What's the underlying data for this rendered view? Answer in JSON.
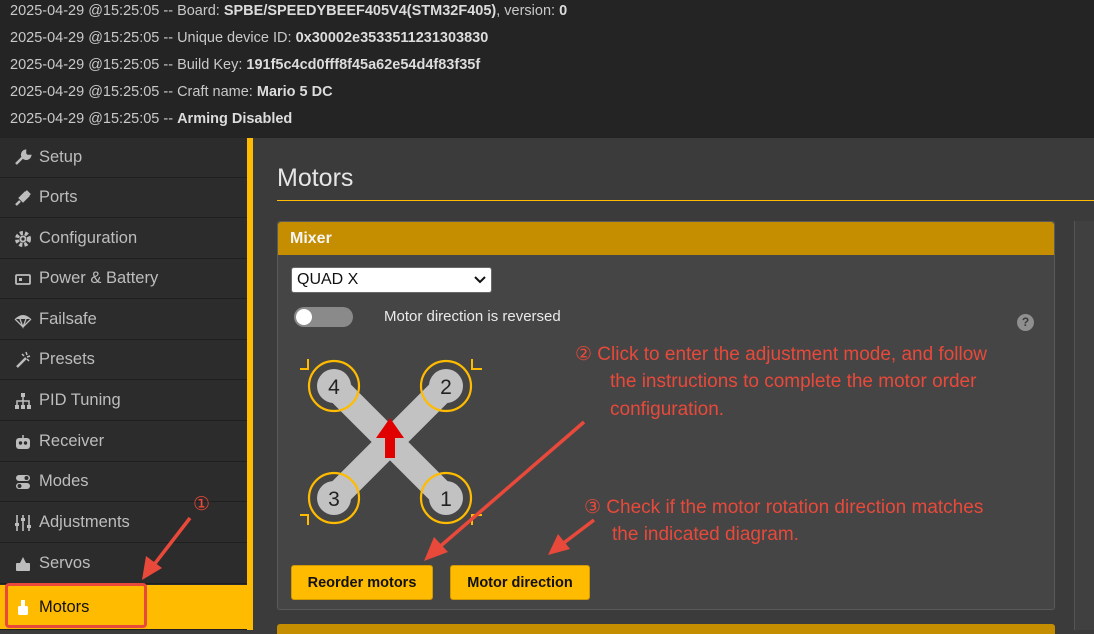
{
  "log": [
    {
      "prefix": "2025-04-29 @15:25:05 -- Board: ",
      "bold": "SPBE/SPEEDYBEEF405V4(STM32F405)",
      "suffix": ", version: ",
      "bold2": "0"
    },
    {
      "prefix": "2025-04-29 @15:25:05 -- Unique device ID: ",
      "bold": "0x30002e3533511231303830",
      "suffix": "",
      "bold2": ""
    },
    {
      "prefix": "2025-04-29 @15:25:05 -- Build Key: ",
      "bold": "191f5c4cd0fff8f45a62e54d4f83f35f",
      "suffix": "",
      "bold2": ""
    },
    {
      "prefix": "2025-04-29 @15:25:05 -- Craft name: ",
      "bold": "Mario 5 DC",
      "suffix": "",
      "bold2": ""
    },
    {
      "prefix": "2025-04-29 @15:25:05 -- ",
      "bold": "Arming Disabled",
      "suffix": "",
      "bold2": ""
    }
  ],
  "sidebar": {
    "items": [
      {
        "label": "Setup",
        "icon": "wrench-icon"
      },
      {
        "label": "Ports",
        "icon": "plug-icon"
      },
      {
        "label": "Configuration",
        "icon": "gear-icon"
      },
      {
        "label": "Power & Battery",
        "icon": "battery-icon"
      },
      {
        "label": "Failsafe",
        "icon": "parachute-icon"
      },
      {
        "label": "Presets",
        "icon": "magic-wand-icon"
      },
      {
        "label": "PID Tuning",
        "icon": "sitemap-icon"
      },
      {
        "label": "Receiver",
        "icon": "robot-icon"
      },
      {
        "label": "Modes",
        "icon": "toggle-icon"
      },
      {
        "label": "Adjustments",
        "icon": "sliders-icon"
      },
      {
        "label": "Servos",
        "icon": "servo-icon"
      },
      {
        "label": "Motors",
        "icon": "motor-icon"
      }
    ],
    "active": "Motors",
    "accent": "#ffbb00"
  },
  "main": {
    "title": "Motors",
    "mixer": {
      "header": "Mixer",
      "selected": "QUAD X",
      "toggle_label": "Motor direction is reversed",
      "toggle_on": false,
      "help": "?",
      "motors": [
        "4",
        "2",
        "3",
        "1"
      ],
      "reorder_button": "Reorder motors",
      "direction_button": "Motor direction"
    }
  },
  "annotations": {
    "a1": "①",
    "a2_line1": "② Click to enter the adjustment mode, and follow",
    "a2_line2": "the instructions to complete the motor order",
    "a2_line3": "configuration.",
    "a3_line1": "③ Check if the motor rotation direction matches",
    "a3_line2": "the indicated diagram.",
    "color": "#e8493a"
  }
}
